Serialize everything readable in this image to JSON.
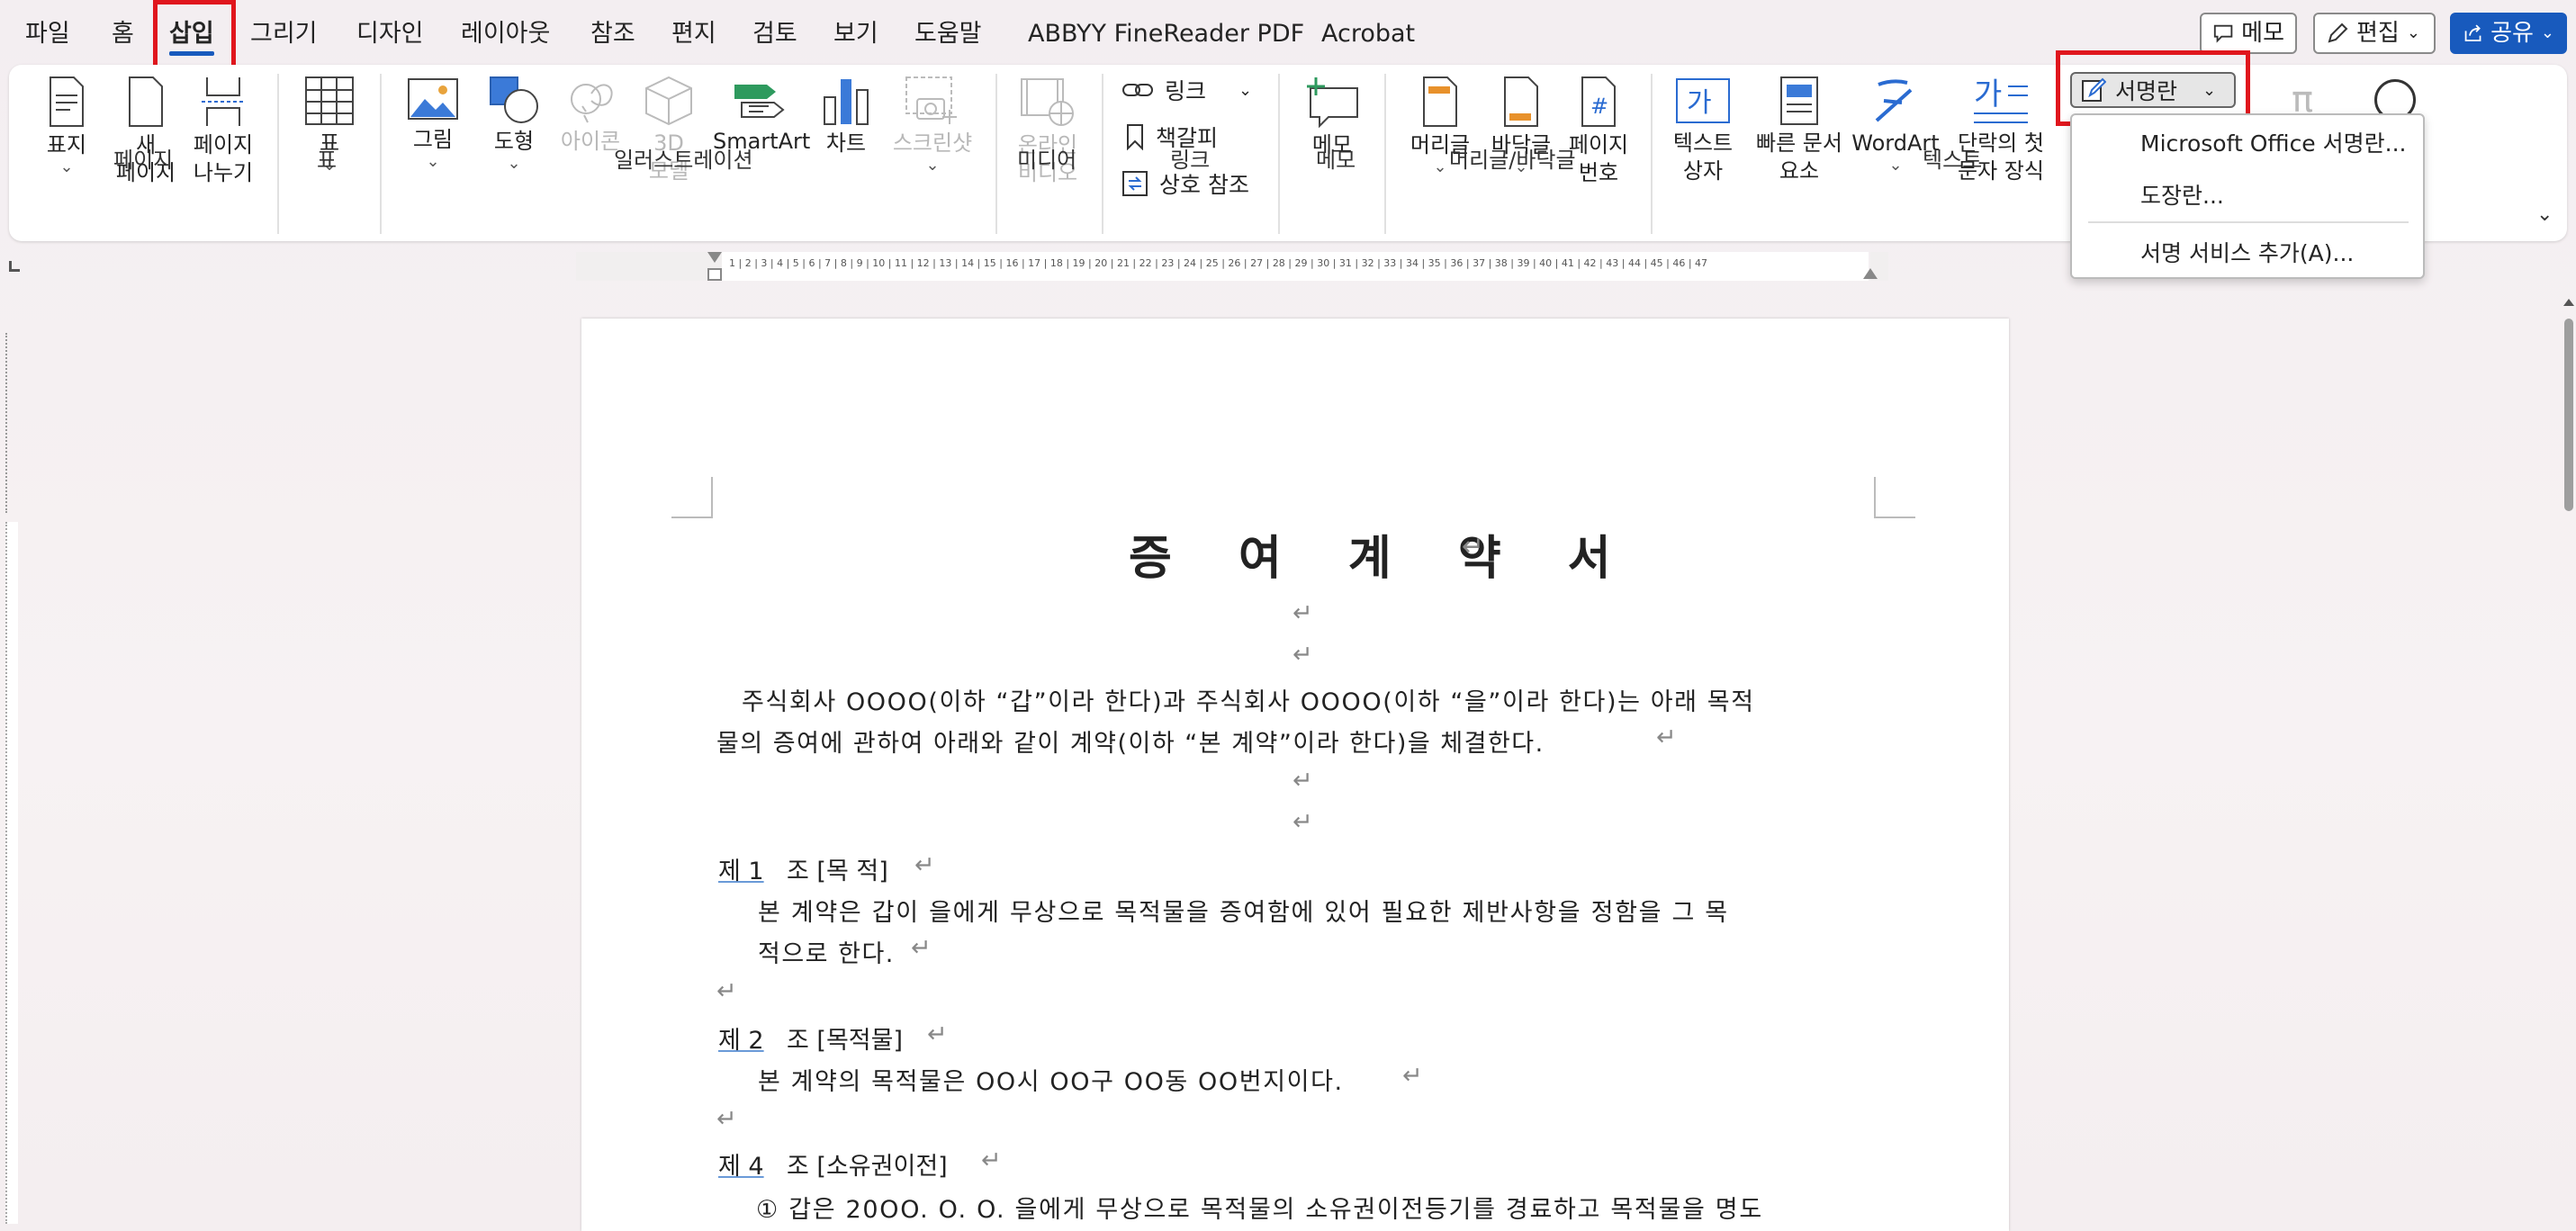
{
  "menu": {
    "tabs": [
      "파일",
      "홈",
      "삽입",
      "그리기",
      "디자인",
      "레이아웃",
      "참조",
      "편지",
      "검토",
      "보기",
      "도움말",
      "ABBYY FineReader PDF",
      "Acrobat"
    ],
    "active_tab": "삽입"
  },
  "top_buttons": {
    "memo": "메모",
    "edit": "편집",
    "share": "공유"
  },
  "ribbon": {
    "page_group": {
      "cover": "표지",
      "new_page_1": "새",
      "new_page_2": "페이지",
      "break_1": "페이지",
      "break_2": "나누기",
      "label": "페이지"
    },
    "table_group": {
      "table": "표",
      "label": "표"
    },
    "illust_group": {
      "picture": "그림",
      "shapes": "도형",
      "icons": "아이콘",
      "model_1": "3D",
      "model_2": "모델",
      "smartart": "SmartArt",
      "chart": "차트",
      "screenshot": "스크린샷",
      "label": "일러스트레이션"
    },
    "media_group": {
      "online_1": "온라인",
      "online_2": "비디오",
      "label": "미디어"
    },
    "link_group": {
      "link": "링크",
      "bookmark": "책갈피",
      "crossref": "상호 참조",
      "label": "링크"
    },
    "comment_group": {
      "memo": "메모",
      "label": "메모"
    },
    "header_group": {
      "header": "머리글",
      "footer": "바닥글",
      "pagenum_1": "페이지",
      "pagenum_2": "번호",
      "label": "머리글/바닥글"
    },
    "text_group": {
      "textbox_1": "텍스트",
      "textbox_2": "상자",
      "quick_1": "빠른 문서",
      "quick_2": "요소",
      "wordart": "WordArt",
      "dropcap_1": "단락의 첫",
      "dropcap_2": "문자 장식",
      "label": "텍스트",
      "signature_line": "서명란"
    }
  },
  "dropdown": {
    "items": [
      "Microsoft Office 서명란...",
      "도장란...",
      "서명 서비스 추가(A)..."
    ]
  },
  "ruler": {
    "numbers": "1 | 2 | 3 | 4 | 5 | 6 | 7 | 8 | 9 | 10 | 11 | 12 | 13 | 14 | 15 | 16 | 17 | 18 | 19 | 20 | 21 | 22 | 23 | 24 | 25 | 26 | 27 | 28 | 29 | 30 | 31 | 32 | 33 | 34 | 35 | 36 | 37 | 38 | 39 | 40 | 41 | 42 | 43 | 44 | 45 | 46 | 47"
  },
  "document": {
    "title": "증 여 계 약 서",
    "intro_1": "주식회사 OOOO(이하 “갑”이라 한다)과 주식회사 OOOO(이하 “을”이라 한다)는 아래 목적",
    "intro_2": "물의 증여에 관하여 아래와 같이 계약(이하 “본 계약”이라 한다)을 체결한다.",
    "art1_num": "제 1",
    "art1_title": "조 [목 적]",
    "art1_body_1": "본 계약은 갑이 을에게 무상으로 목적물을 증여함에 있어 필요한 제반사항을 정함을 그 목",
    "art1_body_2": "적으로 한다.",
    "art2_num": "제 2",
    "art2_title": "조 [목적물]",
    "art2_body": "본 계약의 목적물은 OO시 OO구 OO동 OO번지이다.",
    "art4_num": "제 4",
    "art4_title": "조 [소유권이전]",
    "art4_body": "① 갑은 20OO. O. O. 을에게 무상으로 목적물의 소유권이전등기를 경료하고 목적물을 명도",
    "para_mark": "↵"
  },
  "colors": {
    "accent": "#185abd",
    "highlight_box": "#e0161d"
  }
}
